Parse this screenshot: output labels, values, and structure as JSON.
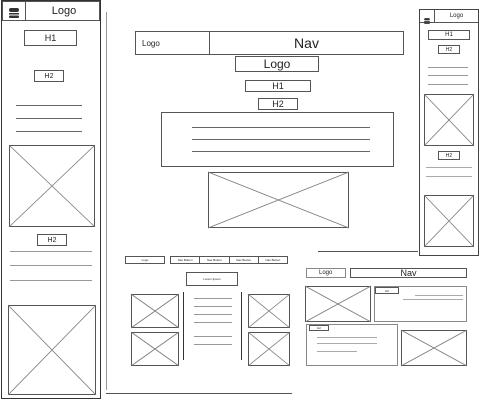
{
  "mobile_left": {
    "logo": "Logo",
    "h1": "H1",
    "h2_top": "H2",
    "h2_bottom": "H2"
  },
  "desktop_main": {
    "logo": "Logo",
    "nav": "Nav",
    "logo_center": "Logo",
    "h1": "H1",
    "h2": "H2"
  },
  "mobile_right": {
    "logo": "Logo",
    "h1": "H1",
    "h2_top": "H2",
    "h2_mid": "H2"
  },
  "tablet_bottom": {
    "logo": "Logo",
    "nav_buttons": [
      "Nav Button",
      "Nav Button",
      "Nav Button",
      "Nav Button"
    ],
    "center_label": "Lorem Ipsum"
  },
  "desktop_bottom_right": {
    "logo": "Logo",
    "nav": "Nav",
    "card_label_1": "H2",
    "card_label_2": "H2"
  },
  "icons": [
    "hamburger-menu-icon",
    "image-placeholder-icon"
  ]
}
